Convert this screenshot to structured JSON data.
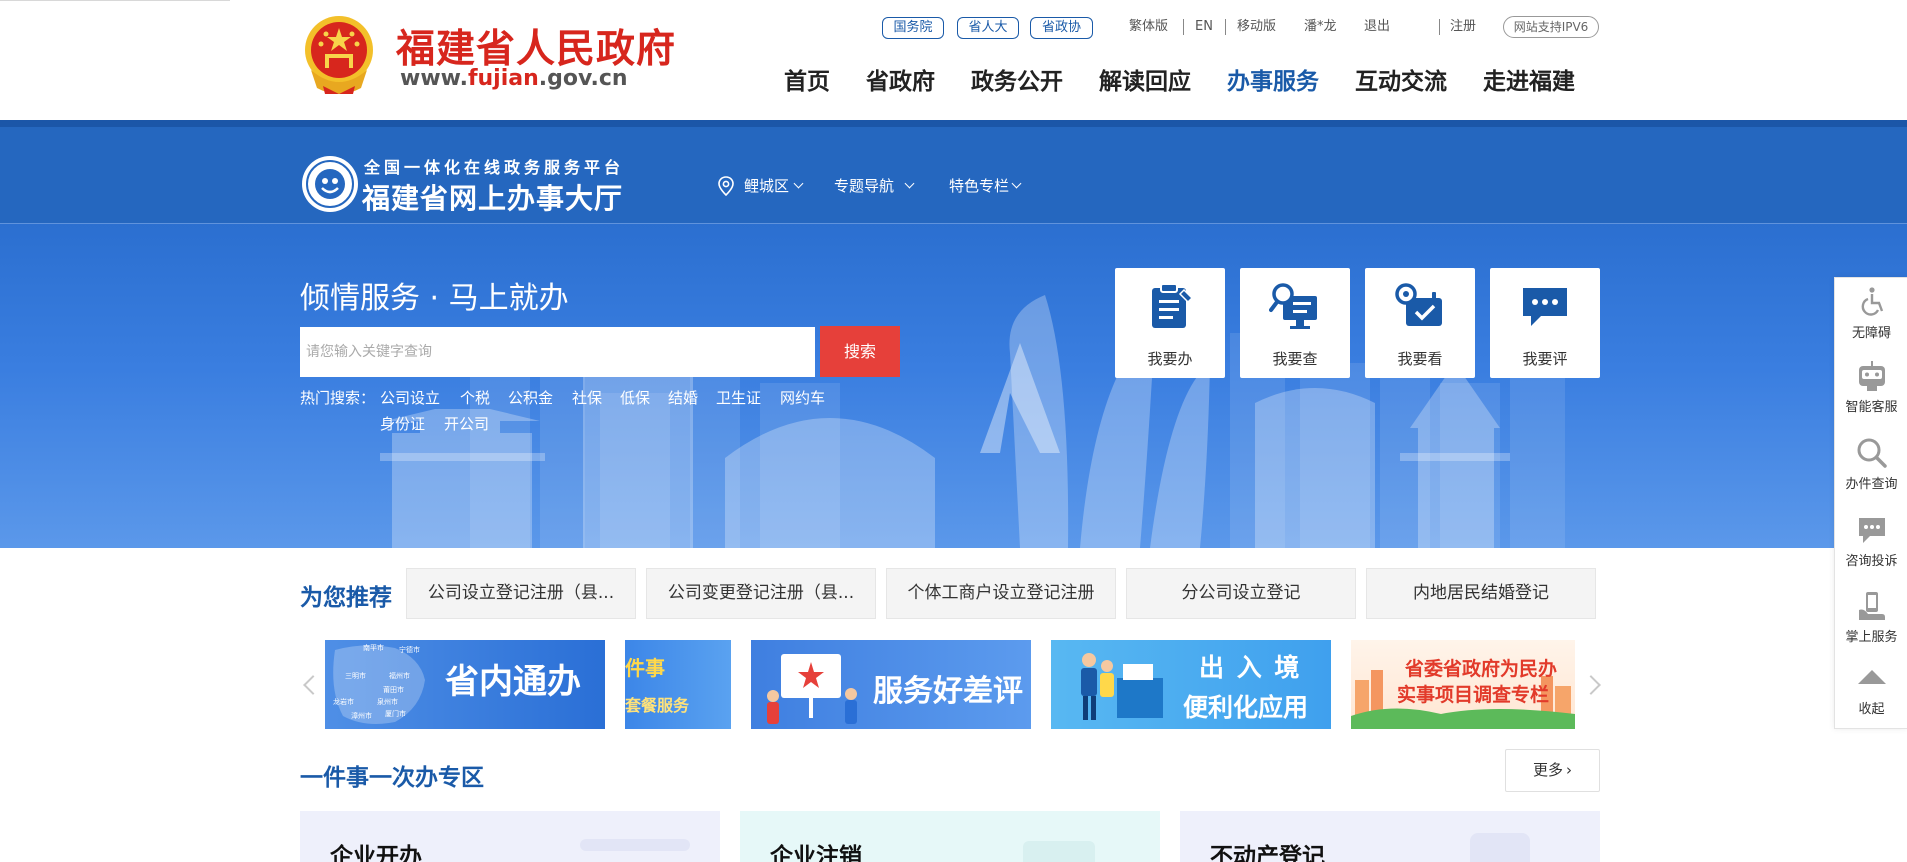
{
  "header": {
    "site_title": "福建省人民政府",
    "site_url_prefix": "www.",
    "site_url_brand": "fujian",
    "site_url_suffix": ".gov.cn",
    "top_pills": [
      "国务院",
      "省人大",
      "省政协"
    ],
    "top_links": [
      "繁体版",
      "EN",
      "移动版",
      "潘*龙",
      "退出",
      "注册"
    ],
    "ipv6_badge": "网站支持IPV6",
    "nav": [
      "首页",
      "省政府",
      "政务公开",
      "解读回应",
      "办事服务",
      "互动交流",
      "走进福建"
    ],
    "active_nav": "办事服务"
  },
  "hall": {
    "subtitle": "全国一体化在线政务服务平台",
    "title": "福建省网上办事大厅",
    "region": "鲤城区",
    "menus": [
      "专题导航",
      "特色专栏"
    ]
  },
  "hero": {
    "slogan": "倾情服务 · 马上就办",
    "search_placeholder": "请您输入关键字查询",
    "search_button": "搜索",
    "hot_label": "热门搜索：",
    "hot_items": [
      "公司设立",
      "个税",
      "公积金",
      "社保",
      "低保",
      "结婚",
      "卫生证",
      "网约车",
      "身份证",
      "开公司"
    ],
    "services": [
      {
        "label": "我要办",
        "icon": "clipboard-pen-icon"
      },
      {
        "label": "我要查",
        "icon": "search-screen-icon"
      },
      {
        "label": "我要看",
        "icon": "calendar-check-icon"
      },
      {
        "label": "我要评",
        "icon": "chat-bubble-icon"
      }
    ]
  },
  "sidebar": [
    {
      "label": "无障碍",
      "icon": "wheelchair-icon"
    },
    {
      "label": "智能客服",
      "icon": "robot-icon"
    },
    {
      "label": "办件查询",
      "icon": "search-icon"
    },
    {
      "label": "咨询投诉",
      "icon": "chat-icon"
    },
    {
      "label": "掌上服务",
      "icon": "hand-phone-icon"
    },
    {
      "label": "收起",
      "icon": "caret-up-icon"
    }
  ],
  "recommend": {
    "title": "为您推荐",
    "items": [
      "公司设立登记注册（县...",
      "公司变更登记注册（县...",
      "个体工商户设立登记注册",
      "分公司设立登记",
      "内地居民结婚登记"
    ]
  },
  "banners": [
    {
      "text": "省内通办",
      "map_labels": [
        "南平市",
        "宁德市",
        "三明市",
        "福州市",
        "莆田市",
        "泉州市",
        "龙岩市",
        "漳州市",
        "厦门市"
      ]
    },
    {
      "text_top": "件事",
      "text_bottom": "套餐服务"
    },
    {
      "text": "服务好差评"
    },
    {
      "line1": "出 入 境",
      "line2": "便利化应用"
    },
    {
      "line1": "省委省政府为民办",
      "line2": "实事项目调查专栏"
    }
  ],
  "section": {
    "title": "一件事一次办专区",
    "more": "更多",
    "cards": [
      "企业开办",
      "企业注销",
      "不动产登记"
    ]
  },
  "colors": {
    "brand_red": "#d7261d",
    "gov_blue": "#1a5aa8",
    "hall_blue": "#2567bf",
    "search_red": "#e6403a"
  }
}
